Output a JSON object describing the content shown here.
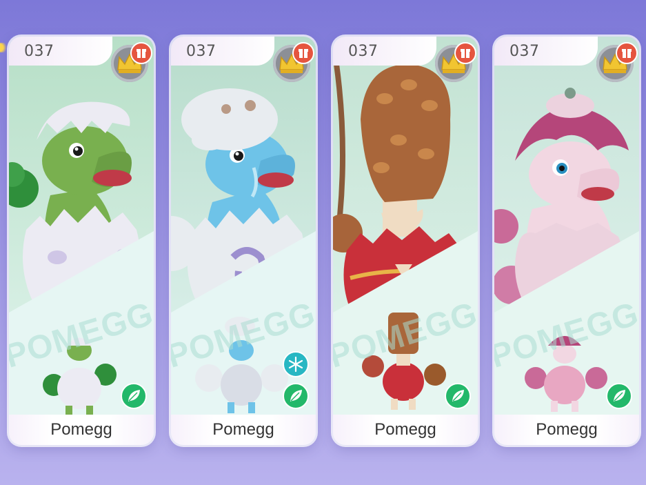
{
  "cards": [
    {
      "number": "037",
      "name": "Pomegg",
      "variant": "grass",
      "colors": {
        "body": "#79b04f",
        "shell": "#ecebf3",
        "spot": "#cfc6e6",
        "accent": "#2f8f3b",
        "bg_top": "#b7dfc7",
        "bg_bottom": "#dff5f0"
      },
      "badges": [
        "crown-icon",
        "gift-icon",
        "grass-type-icon"
      ]
    },
    {
      "number": "037",
      "name": "Pomegg",
      "variant": "ice",
      "colors": {
        "body": "#6ec3e8",
        "shell": "#e8ecf0",
        "spot": "#9c8fcf",
        "accent": "#d9dde3",
        "bg_top": "#b7dccb",
        "bg_bottom": "#e0f4f3"
      },
      "badges": [
        "crown-icon",
        "gift-icon",
        "ice-type-icon",
        "grass-type-icon"
      ]
    },
    {
      "number": "037",
      "name": "Pomegg",
      "variant": "autumn",
      "colors": {
        "body": "#f0dcc3",
        "shell": "#c9303a",
        "spot": "#e8b448",
        "accent": "#9a5a2c",
        "bg_top": "#c2e2d2",
        "bg_bottom": "#e3f4ef"
      },
      "badges": [
        "crown-icon",
        "gift-icon",
        "grass-type-icon"
      ]
    },
    {
      "number": "037",
      "name": "Pomegg",
      "variant": "blossom",
      "colors": {
        "body": "#f2d7e2",
        "shell": "#ecd2de",
        "spot": "#e8a7c2",
        "accent": "#b5467a",
        "bg_top": "#c6e3d8",
        "bg_bottom": "#e3f3ef"
      },
      "badges": [
        "crown-icon",
        "gift-icon",
        "grass-type-icon"
      ]
    }
  ],
  "watermark": "POMEGG",
  "ui_colors": {
    "crown": "#f1c531",
    "gift": "#e5553f",
    "grass": "#23b86a",
    "ice": "#27b7c3"
  }
}
